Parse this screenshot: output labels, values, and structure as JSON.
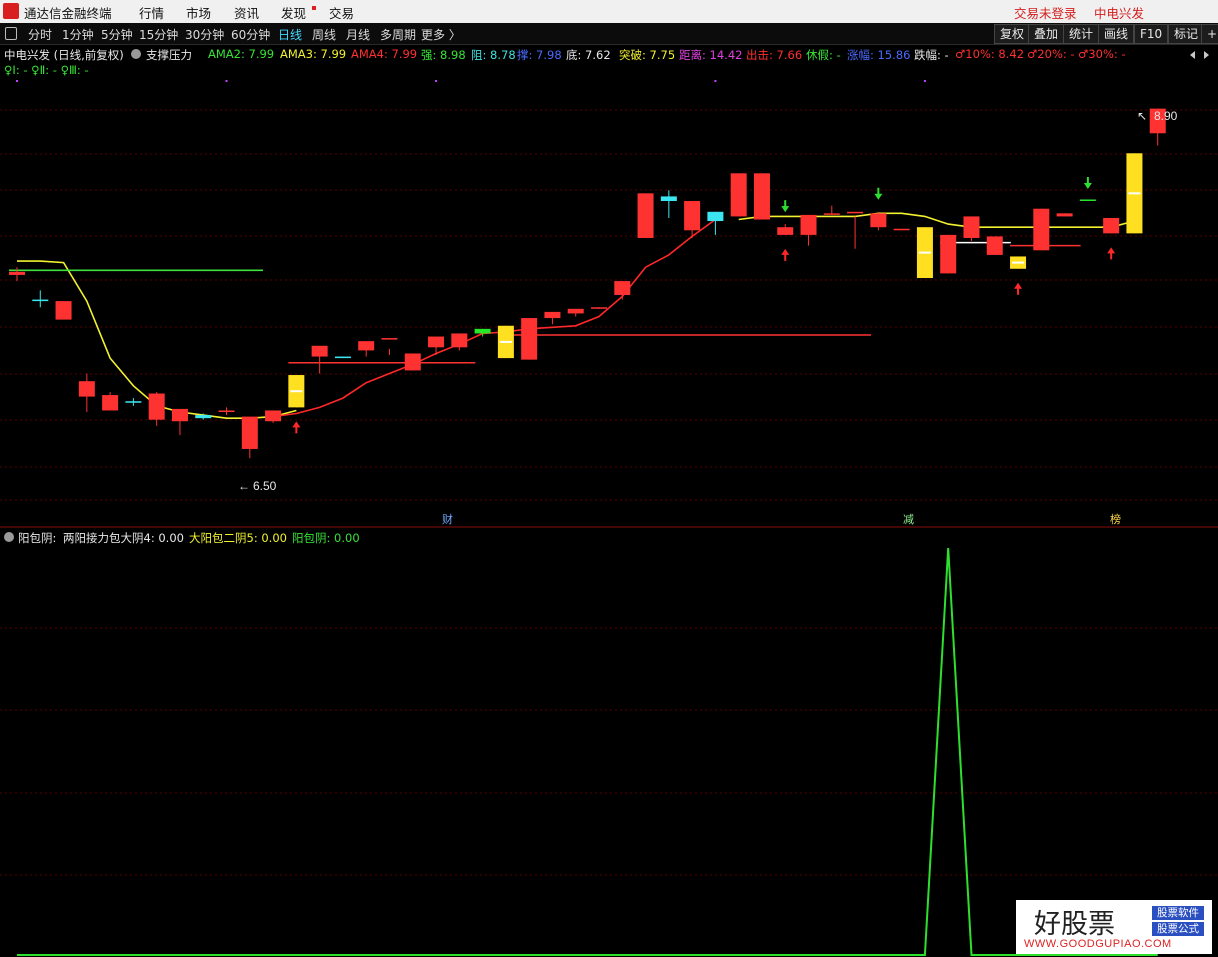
{
  "titlebar": {
    "app_name": "通达信金融终端",
    "menu": [
      "行情",
      "市场",
      "资讯",
      "发现",
      "交易"
    ],
    "login_status": "交易未登录",
    "stock_name": "中电兴发"
  },
  "period_bar": {
    "periods": [
      "分时",
      "1分钟",
      "5分钟",
      "15分钟",
      "30分钟",
      "60分钟",
      "日线",
      "周线",
      "月线",
      "多周期",
      "更多 〉"
    ],
    "active_period": "日线",
    "tools": [
      "复权",
      "叠加",
      "统计",
      "画线",
      "F10",
      "标记",
      "+自"
    ]
  },
  "main_indicator": {
    "title": "中电兴发 (日线,前复权)",
    "formula": "支撑压力",
    "items": [
      {
        "text": "AMA2: 7.99",
        "color": "#36e436"
      },
      {
        "text": "AMA3: 7.99",
        "color": "#f2f230"
      },
      {
        "text": "AMA4: 7.99",
        "color": "#ff3030"
      },
      {
        "text": "强: 8.98",
        "color": "#36e436"
      },
      {
        "text": "阻: 8.78",
        "color": "#40e0e0"
      },
      {
        "text": "撑: 7.98",
        "color": "#4a6aff"
      },
      {
        "text": "底: 7.62",
        "color": "#e8e8e8"
      },
      {
        "text": "突破: 7.75",
        "color": "#f2f230"
      },
      {
        "text": "距离: 14.42",
        "color": "#e040e0"
      },
      {
        "text": "出击: 7.66",
        "color": "#ff3030"
      },
      {
        "text": "休假: -",
        "color": "#36e436"
      },
      {
        "text": "涨幅: 15.86",
        "color": "#4a6aff"
      },
      {
        "text": "跌幅: -",
        "color": "#e8e8e8"
      },
      {
        "text": "♂10%: 8.42",
        "color": "#ff3030"
      },
      {
        "text": "♂20%: -",
        "color": "#ff3030"
      },
      {
        "text": "♂30%: -",
        "color": "#ff3030"
      }
    ],
    "row2": "♀Ⅰ: -  ♀Ⅱ: -  ♀Ⅲ: -"
  },
  "sub_indicator": {
    "name": "阳包阴:",
    "items": [
      {
        "text": "两阳接力包大阴4: 0.00",
        "color": "#e8e8e8"
      },
      {
        "text": "大阳包二阴5: 0.00",
        "color": "#f2f230"
      },
      {
        "text": "阳包阴: 0.00",
        "color": "#36e436"
      }
    ]
  },
  "colors": {
    "up": "#ff3232",
    "down": "#3ce6f0",
    "yellow_bar": "#ffe020",
    "green_bar": "#28e628",
    "grid": "#5a0000"
  },
  "annotations": {
    "high_label": "8.90",
    "low_label": "6.50",
    "events": [
      "财",
      "减",
      "榜"
    ]
  },
  "chart_data": {
    "type": "candlestick",
    "series": [
      {
        "name": "price",
        "candles": [
          [
            7.84,
            7.89,
            7.8,
            7.86
          ],
          [
            7.68,
            7.74,
            7.63,
            7.67
          ],
          [
            7.55,
            7.67,
            7.55,
            7.67
          ],
          [
            7.05,
            7.2,
            6.95,
            7.15
          ],
          [
            6.96,
            7.08,
            6.96,
            7.06
          ],
          [
            7.02,
            7.04,
            6.99,
            7.01
          ],
          [
            6.9,
            7.08,
            6.86,
            7.07
          ],
          [
            6.89,
            6.97,
            6.8,
            6.97
          ],
          [
            6.93,
            6.94,
            6.9,
            6.91
          ],
          [
            6.95,
            6.98,
            6.93,
            6.96
          ],
          [
            6.71,
            6.92,
            6.65,
            6.92
          ],
          [
            6.89,
            6.95,
            6.88,
            6.96
          ],
          [
            6.98,
            7.19,
            6.98,
            7.19
          ],
          [
            7.31,
            7.36,
            7.2,
            7.38
          ],
          [
            7.31,
            7.31,
            7.3,
            7.3
          ],
          [
            7.35,
            7.41,
            7.31,
            7.41
          ],
          [
            7.42,
            7.36,
            7.32,
            7.43
          ],
          [
            7.22,
            7.31,
            7.22,
            7.33
          ],
          [
            7.37,
            7.43,
            7.32,
            7.44
          ],
          [
            7.37,
            7.43,
            7.35,
            7.46
          ],
          [
            7.46,
            7.49,
            7.44,
            7.49
          ],
          [
            7.51,
            7.51,
            7.3,
            7.3
          ],
          [
            7.29,
            7.56,
            7.29,
            7.56
          ],
          [
            7.56,
            7.6,
            7.52,
            7.6
          ],
          [
            7.59,
            7.62,
            7.57,
            7.62
          ],
          [
            7.63,
            7.63,
            7.62,
            7.63
          ],
          [
            7.71,
            7.8,
            7.68,
            7.8
          ],
          [
            8.08,
            8.37,
            8.08,
            8.37
          ],
          [
            8.35,
            8.39,
            8.21,
            8.32
          ],
          [
            8.13,
            8.32,
            8.08,
            8.32
          ],
          [
            8.25,
            8.25,
            8.1,
            8.19
          ],
          [
            8.22,
            8.5,
            8.22,
            8.5
          ],
          [
            8.2,
            8.5,
            8.2,
            8.5
          ],
          [
            8.1,
            8.17,
            8.1,
            8.15
          ],
          [
            8.1,
            8.22,
            8.03,
            8.23
          ],
          [
            8.24,
            8.29,
            8.23,
            8.24
          ],
          [
            8.24,
            8.22,
            8.01,
            8.25
          ],
          [
            8.15,
            8.25,
            8.13,
            8.24
          ],
          [
            8.13,
            8.1,
            8.1,
            8.14
          ],
          [
            7.82,
            8.15,
            7.82,
            8.15
          ],
          [
            7.85,
            8.1,
            7.85,
            8.1
          ],
          [
            8.08,
            8.22,
            8.06,
            8.22
          ],
          [
            7.97,
            8.09,
            7.97,
            8.09
          ],
          [
            7.88,
            7.95,
            7.88,
            7.96
          ],
          [
            8.0,
            8.27,
            8.0,
            8.27
          ],
          [
            8.22,
            8.24,
            8.22,
            8.24
          ],
          [
            8.33,
            8.32,
            8.33,
            8.33
          ],
          [
            8.11,
            8.21,
            8.11,
            8.21
          ],
          [
            8.11,
            8.63,
            8.11,
            8.63
          ],
          [
            8.76,
            8.9,
            8.68,
            8.92
          ]
        ]
      },
      {
        "name": "yellow_line",
        "values": [
          7.93,
          7.93,
          7.92,
          7.67,
          7.3,
          7.12,
          6.99,
          6.95,
          6.93,
          6.91,
          6.91,
          6.92,
          6.96,
          null,
          null,
          null,
          null,
          null,
          null,
          null,
          null,
          null,
          null,
          null,
          null,
          null,
          null,
          null,
          null,
          null,
          null,
          8.2,
          8.22,
          8.22,
          8.22,
          8.22,
          8.22,
          8.24,
          8.24,
          8.22,
          8.17,
          8.15,
          8.15,
          8.15,
          8.15,
          8.15,
          8.15,
          8.15,
          8.19,
          null
        ]
      },
      {
        "name": "red_line",
        "values": [
          null,
          null,
          null,
          null,
          null,
          null,
          null,
          null,
          null,
          null,
          null,
          6.92,
          6.94,
          6.98,
          7.04,
          7.14,
          7.2,
          7.26,
          7.33,
          7.39,
          7.46,
          7.47,
          7.49,
          7.5,
          7.51,
          7.57,
          7.7,
          7.89,
          7.97,
          8.09,
          8.2,
          null,
          null,
          null,
          null,
          null,
          null,
          null,
          null,
          null,
          null,
          null,
          null,
          null,
          null,
          null,
          null,
          null,
          null,
          8.4
        ]
      },
      {
        "name": "green_line",
        "values": [
          7.87,
          7.87,
          7.87,
          7.87,
          7.87,
          7.87,
          7.87,
          7.87,
          7.87,
          7.87,
          7.87
        ]
      }
    ],
    "ylim": [
      6.45,
      8.95
    ],
    "levels": [
      {
        "value": 7.27,
        "from": 12,
        "to": 19,
        "color": "#ff3232"
      },
      {
        "value": 7.45,
        "from": 21,
        "to": 36,
        "color": "#ff3232"
      },
      {
        "value": 8.03,
        "from": 43,
        "to": 45,
        "color": "#ff3232"
      },
      {
        "value": 8.05,
        "from": 40,
        "to": 42,
        "color": "#ffffff"
      }
    ],
    "sub_values": [
      0,
      0,
      0,
      0,
      0,
      0,
      0,
      0,
      0,
      0,
      0,
      0,
      0,
      0,
      0,
      0,
      0,
      0,
      0,
      0,
      0,
      0,
      0,
      0,
      0,
      0,
      0,
      0,
      0,
      0,
      0,
      0,
      0,
      0,
      0,
      0,
      0,
      0,
      0,
      0,
      1,
      0,
      0,
      0,
      0,
      0,
      0,
      0,
      0,
      0
    ]
  },
  "watermark": {
    "big": "好股票",
    "badge1": "股票软件",
    "badge2": "股票公式",
    "url": "WWW.GOODGUPIAO.COM"
  }
}
